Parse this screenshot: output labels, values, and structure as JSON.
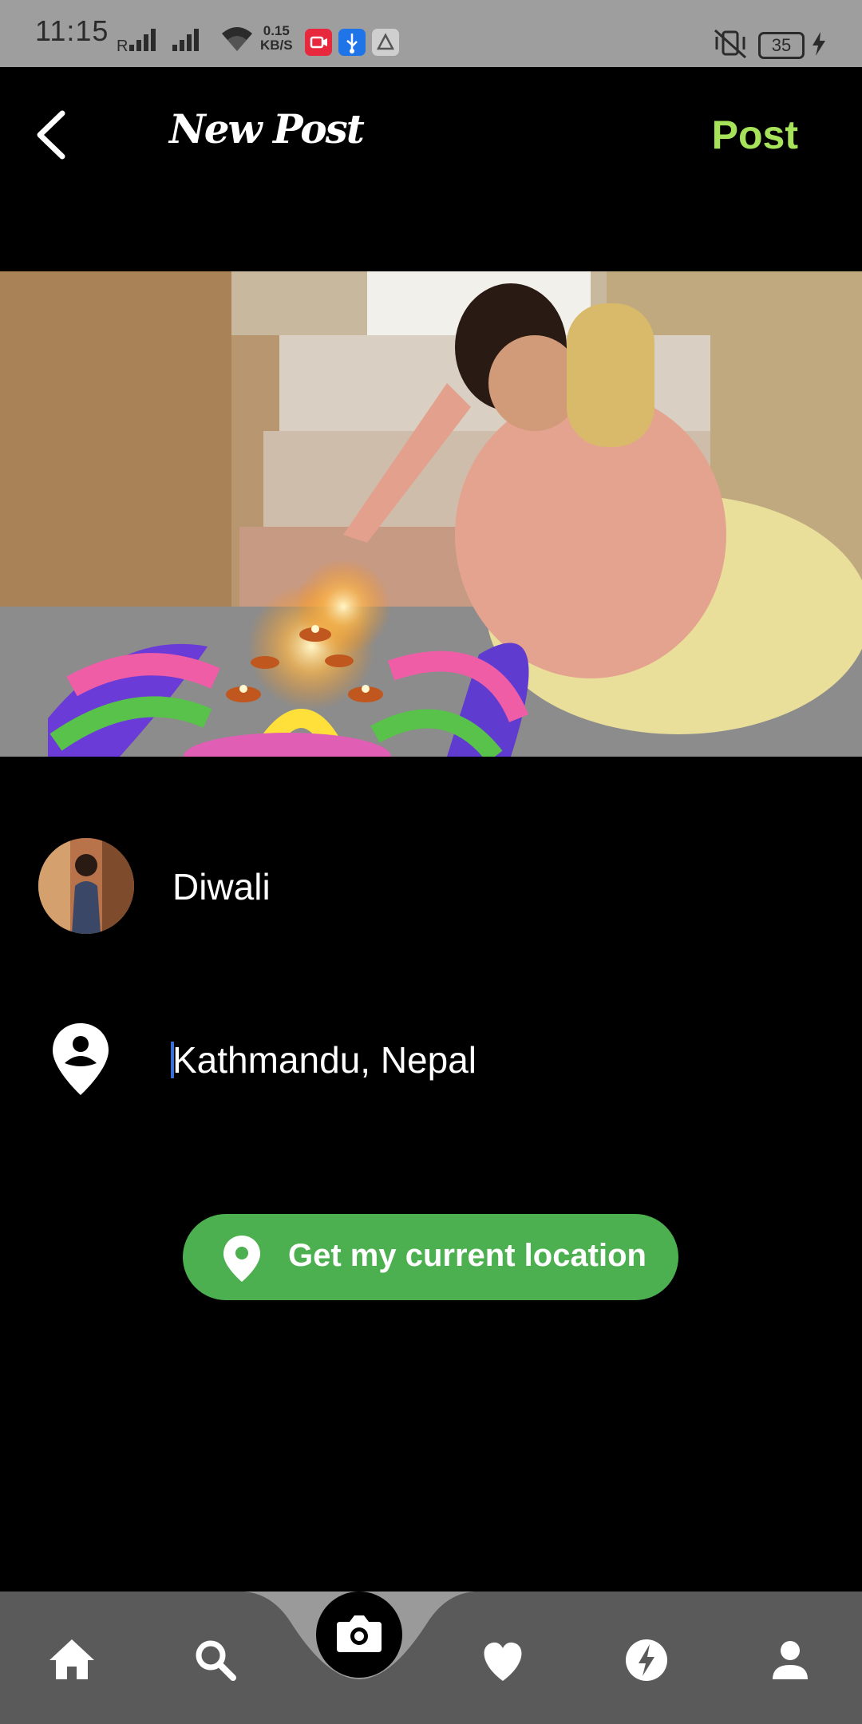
{
  "status_bar": {
    "time": "11:15",
    "network_speed_value": "0.15",
    "network_speed_unit": "KB/S",
    "battery": "35"
  },
  "header": {
    "title": "New Post",
    "post_label": "Post",
    "accent_color": "#a6e35a"
  },
  "photo": {
    "description_icon": "photo-diwali-diyas"
  },
  "caption": {
    "value": "Diwali"
  },
  "location": {
    "value": "Kathmandu, Nepal"
  },
  "location_button": {
    "label": "Get my current location",
    "color": "#4caf50"
  },
  "bottom_nav": {
    "items": [
      "home-icon",
      "search-icon",
      "camera-icon",
      "heart-icon",
      "activity-icon",
      "profile-icon"
    ]
  }
}
